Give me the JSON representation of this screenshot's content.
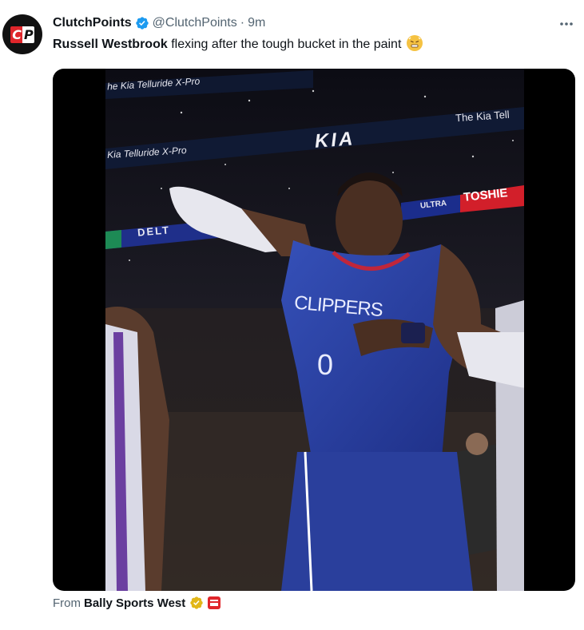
{
  "author": {
    "name": "ClutchPoints",
    "handle": "@ClutchPoints",
    "separator": "·",
    "time": "9m",
    "avatar_text_c": "C",
    "avatar_text_p": "P"
  },
  "tweet": {
    "bold_part": "Russell Westbrook",
    "rest": " flexing after the tough bucket in the paint"
  },
  "video_scene": {
    "banner_top_left": "he Kia Telluride X-Pro",
    "banner_mid_left": "Kia Telluride X-Pro",
    "banner_right": "The Kia Tell",
    "brand_logo": "KIA",
    "sign_delta": "DELT",
    "sign_ultra": "ULTRA",
    "sign_toshiba": "TOSHIE",
    "jersey_team": "CLIPPERS",
    "jersey_number": "0"
  },
  "footer": {
    "prefix": "From",
    "source": "Bally Sports West"
  },
  "colors": {
    "verified_blue": "#1d9bf0",
    "clippers_blue": "#2a3f9c",
    "gold": "#e2b719",
    "red": "#e0262b"
  }
}
